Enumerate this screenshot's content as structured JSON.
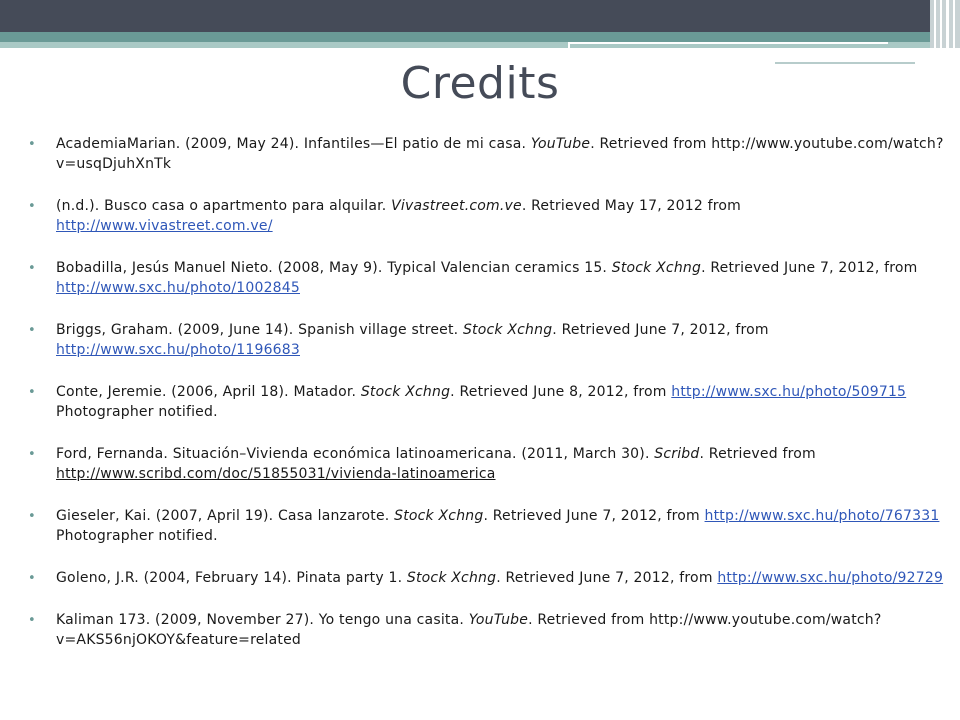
{
  "title": "Credits",
  "theme": {
    "header_dark": "#454b58",
    "header_teal": "#6a9a96",
    "bullet": "#6a9a96",
    "link": "#2f57b8"
  },
  "bullet_icon": "•",
  "references": [
    {
      "lead": "AcademiaMarian.  (2009, May 24).  Infantiles—El patio de mi casa.  ",
      "source": "YouTube",
      "mid": ".  Retrieved from ",
      "url": "http://www.youtube.com/watch?v=usqDjuhXnTk",
      "tail": ""
    },
    {
      "lead": "(n.d.).  Busco casa o apartmento para alquilar.  ",
      "source": "Vivastreet.com.ve",
      "mid": ".  Retrieved May 17, 2012 from ",
      "url": "http://www.vivastreet.com.ve/",
      "tail": ""
    },
    {
      "lead": "Bobadilla, Jesús Manuel Nieto.  (2008, May 9).   Typical Valencian ceramics 15.   ",
      "source": "Stock Xchng",
      "mid": ".  Retrieved June 7, 2012, from ",
      "url": "http://www.sxc.hu/photo/1002845",
      "tail": ""
    },
    {
      "lead": "Briggs, Graham.  (2009, June 14).   Spanish village street.  ",
      "source": "Stock Xchng",
      "mid": ".  Retrieved June 7, 2012, from ",
      "url": "http://www.sxc.hu/photo/1196683",
      "tail": ""
    },
    {
      "lead": "Conte, Jeremie.  (2006, April 18).   Matador.  ",
      "source": "Stock Xchng",
      "mid": ".  Retrieved June 8, 2012, from ",
      "url": "http://www.sxc.hu/photo/509715",
      "tail": "  Photographer notified."
    },
    {
      "lead": "Ford, Fernanda.  Situación–Vivienda económica latinoamericana.  (2011, March 30).   ",
      "source": "Scribd",
      "mid": ".  Retrieved from ",
      "url": "http://www.scribd.com/doc/51855031/vivienda-latinoamerica",
      "tail": ""
    },
    {
      "lead": "Gieseler, Kai.  (2007, April 19).   Casa lanzarote.  ",
      "source": "Stock Xchng",
      "mid": ".  Retrieved June 7, 2012, from ",
      "url": "http://www.sxc.hu/photo/767331",
      "tail": "  Photographer notified."
    },
    {
      "lead": "Goleno, J.R.  (2004, February 14).   Pinata party 1.   ",
      "source": "Stock Xchng",
      "mid": ".  Retrieved June 7, 2012, from ",
      "url": "http://www.sxc.hu/photo/92729",
      "tail": ""
    },
    {
      "lead": "Kaliman 173.  (2009, November 27).   Yo tengo una casita.  ",
      "source": "YouTube",
      "mid": ".  Retrieved from ",
      "url": "http://www.youtube.com/watch?v=AKS56njOKOY&feature=related",
      "tail": ""
    }
  ]
}
